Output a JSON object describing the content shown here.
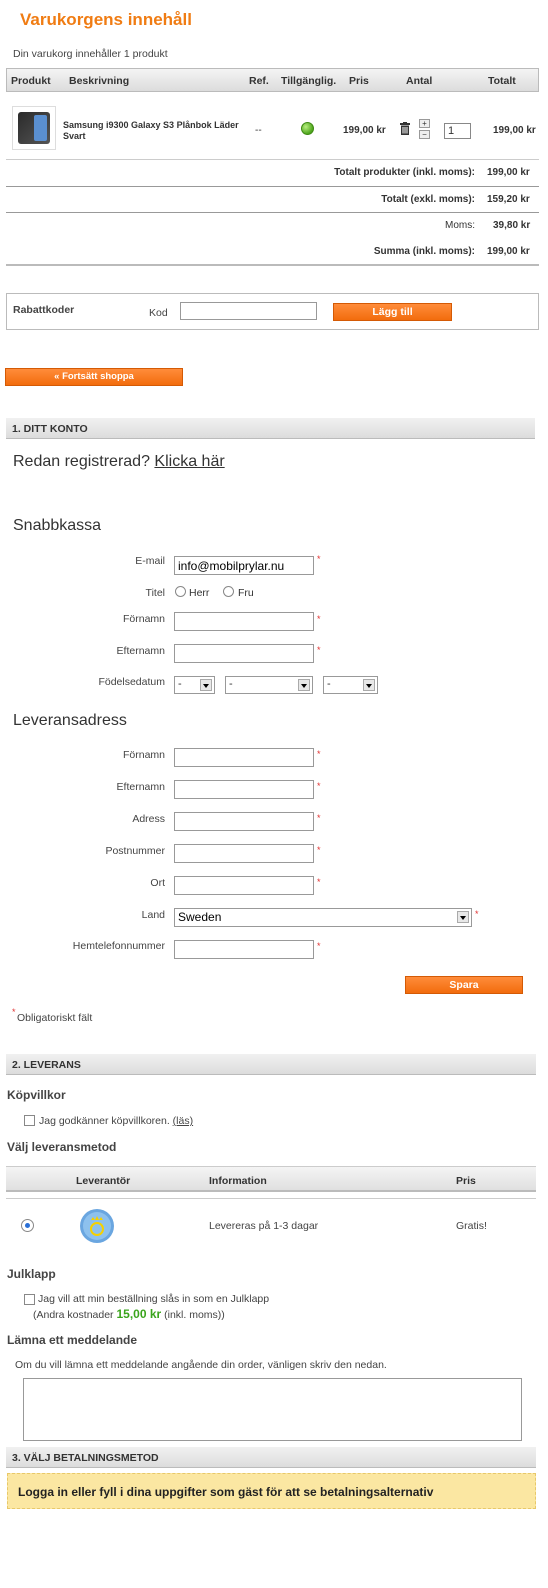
{
  "cart": {
    "title": "Varukorgens innehåll",
    "summary": "Din varukorg innehåller 1 produkt",
    "columns": [
      "Produkt",
      "Beskrivning",
      "Ref.",
      "Tillgänglig.",
      "Pris",
      "Antal",
      "Totalt"
    ],
    "item": {
      "name": "Samsung i9300 Galaxy S3 Plånbok Läder Svart",
      "ref": "--",
      "price": "199,00 kr",
      "qty": "1",
      "total": "199,00 kr",
      "qty_plus": "+",
      "qty_minus": "−",
      "availability_color": "#4ea51c"
    },
    "totals": {
      "products_label": "Totalt produkter (inkl. moms):",
      "products_value": "199,00 kr",
      "excl_label": "Totalt (exkl. moms):",
      "excl_value": "159,20 kr",
      "vat_label": "Moms:",
      "vat_value": "39,80 kr",
      "sum_label": "Summa (inkl. moms):",
      "sum_value": "199,00 kr"
    }
  },
  "discount": {
    "title": "Rabattkoder",
    "code_label": "Kod",
    "code_value": "",
    "add_button": "Lägg till"
  },
  "continue_button": "« Fortsätt shoppa",
  "section1": {
    "title": "1. DITT KONTO",
    "registered_text": "Redan registrerad?",
    "registered_link": "Klicka här",
    "quick_checkout": "Snabbkassa",
    "email_label": "E-mail",
    "email_value": "info@mobilprylar.nu",
    "title_label": "Titel",
    "title_opt1": "Herr",
    "title_opt2": "Fru",
    "firstname_label": "Förnamn",
    "lastname_label": "Efternamn",
    "birthdate_label": "Födelsedatum",
    "birth_day": "-",
    "birth_month": "-",
    "birth_year": "-",
    "delivery_heading": "Leveransadress",
    "d_firstname_label": "Förnamn",
    "d_lastname_label": "Efternamn",
    "address_label": "Adress",
    "postcode_label": "Postnummer",
    "city_label": "Ort",
    "country_label": "Land",
    "country_value": "Sweden",
    "phone_label": "Hemtelefonnummer",
    "save_button": "Spara",
    "required_mark": "*",
    "required_note": "Obligatoriskt fält"
  },
  "section2": {
    "title": "2. LEVERANS",
    "terms_heading": "Köpvillkor",
    "terms_text": "Jag godkänner köpvillkoren.",
    "terms_link": "(läs)",
    "method_heading": "Välj leveransmetod",
    "col_carrier": "Leverantör",
    "col_info": "Information",
    "col_price": "Pris",
    "carrier_info": "Levereras på 1-3 dagar",
    "carrier_price": "Gratis!",
    "gift_heading": "Julklapp",
    "gift_text": "Jag vill att min beställning slås in som en Julklapp",
    "gift_cost_prefix": "(Andra kostnader",
    "gift_cost_value": "15,00 kr",
    "gift_cost_suffix": "(inkl. moms))",
    "message_heading": "Lämna ett meddelande",
    "message_text": "Om du vill lämna ett meddelande angående din order, vänligen skriv den nedan.",
    "message_value": ""
  },
  "section3": {
    "title": "3. VÄLJ BETALNINGSMETOD",
    "notice": "Logga in eller fyll i dina uppgifter som gäst för att se betalningsalternativ"
  },
  "colors": {
    "accent": "#f07c13",
    "button": "#f26c0d",
    "price_highlight": "#3aa41c",
    "notice_bg": "#fbe7a2"
  }
}
